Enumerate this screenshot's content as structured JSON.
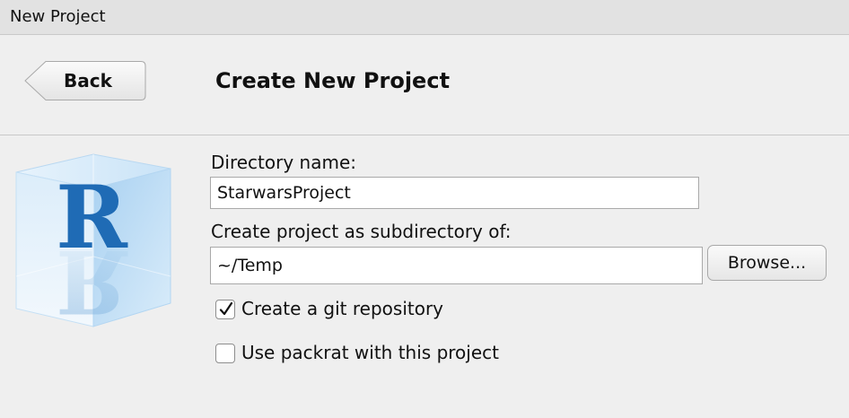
{
  "window": {
    "title": "New Project"
  },
  "header": {
    "back_label": "Back",
    "page_title": "Create New Project"
  },
  "form": {
    "directory_label": "Directory name:",
    "directory_value": "StarwarsProject",
    "parent_label": "Create project as subdirectory of:",
    "parent_value": "~/Temp",
    "browse_label": "Browse...",
    "git_label": "Create a git repository",
    "git_checked": true,
    "packrat_label": "Use packrat with this project",
    "packrat_checked": false
  },
  "logo": {
    "letter": "R",
    "icon": "r-cube-logo"
  },
  "colors": {
    "background": "#efefef",
    "titlebar": "#e2e2e2",
    "logo_blue": "#1f6bb5",
    "cube_light": "#cfe6f8"
  }
}
